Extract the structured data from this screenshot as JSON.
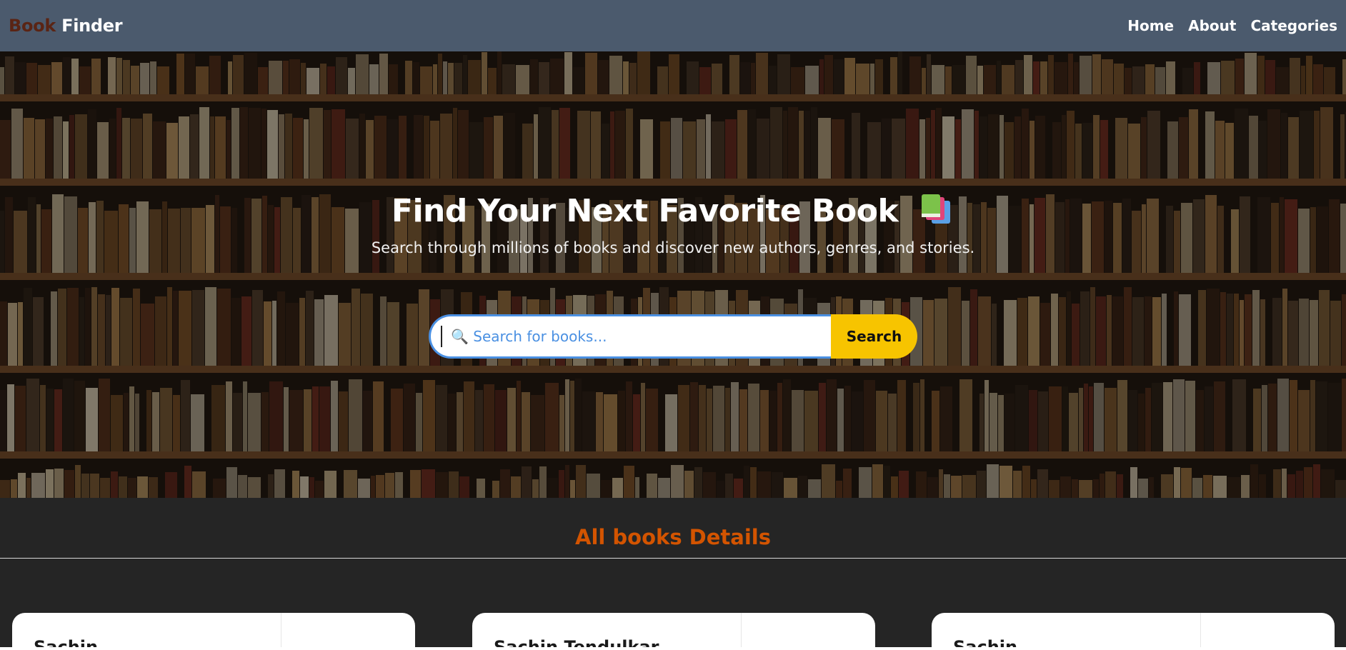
{
  "navbar": {
    "brand_part1": "Book",
    "brand_part2": "Finder",
    "links": [
      "Home",
      "About",
      "Categories"
    ]
  },
  "hero": {
    "title": "Find Your Next Favorite Book",
    "title_icon": "books-icon",
    "subtitle": "Search through millions of books and discover new authors, genres, and stories.",
    "search_placeholder": "🔍 Search for books...",
    "search_value": "",
    "search_button": "Search"
  },
  "section": {
    "title": "All books Details"
  },
  "cards": [
    {
      "name": "Sachin"
    },
    {
      "name": "Sachin Tendulkar"
    },
    {
      "name": "Sachin"
    }
  ],
  "colors": {
    "navbar_bg": "#4b5a6d",
    "brand_accent": "#5a2414",
    "search_button": "#f7c400",
    "search_border": "#4a90e2",
    "section_title": "#d35400",
    "page_bg": "#252525"
  }
}
